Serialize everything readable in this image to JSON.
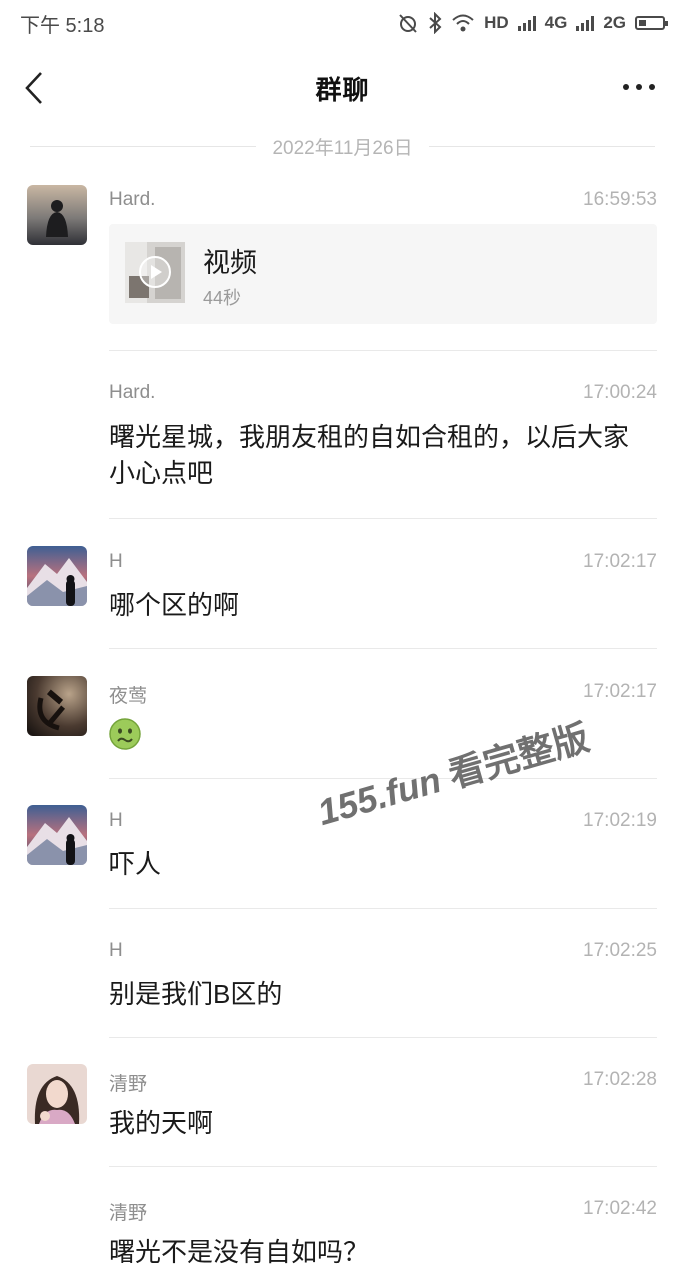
{
  "status_bar": {
    "time": "下午 5:18",
    "network_hd": "HD",
    "network_4g": "4G",
    "network_2g": "2G",
    "battery_level": 0.3
  },
  "nav": {
    "title": "群聊"
  },
  "date_divider": "2022年11月26日",
  "messages": [
    {
      "sender": "Hard.",
      "time": "16:59:53",
      "type": "video",
      "video_label": "视频",
      "video_duration": "44秒"
    },
    {
      "sender": "Hard.",
      "time": "17:00:24",
      "text": "曙光星城，我朋友租的自如合租的，以后大家小心点吧"
    },
    {
      "sender": "H",
      "time": "17:02:17",
      "text": "哪个区的啊"
    },
    {
      "sender": "夜莺",
      "time": "17:02:17",
      "type": "emoji",
      "emoji": "nauseated-face"
    },
    {
      "sender": "H",
      "time": "17:02:19",
      "text": "吓人"
    },
    {
      "sender": "H",
      "time": "17:02:25",
      "text": "别是我们B区的"
    },
    {
      "sender": "清野",
      "time": "17:02:28",
      "text": "我的天啊"
    },
    {
      "sender": "清野",
      "time": "17:02:42",
      "text": "曙光不是没有自如吗？"
    }
  ],
  "watermark": {
    "site": "155.fun",
    "text": "看完整版"
  },
  "colors": {
    "background": "#ffffff",
    "text": "#1a1a1a",
    "muted": "#8e8e8e",
    "time": "#b3b3b3",
    "divider": "#e9e9e9"
  }
}
